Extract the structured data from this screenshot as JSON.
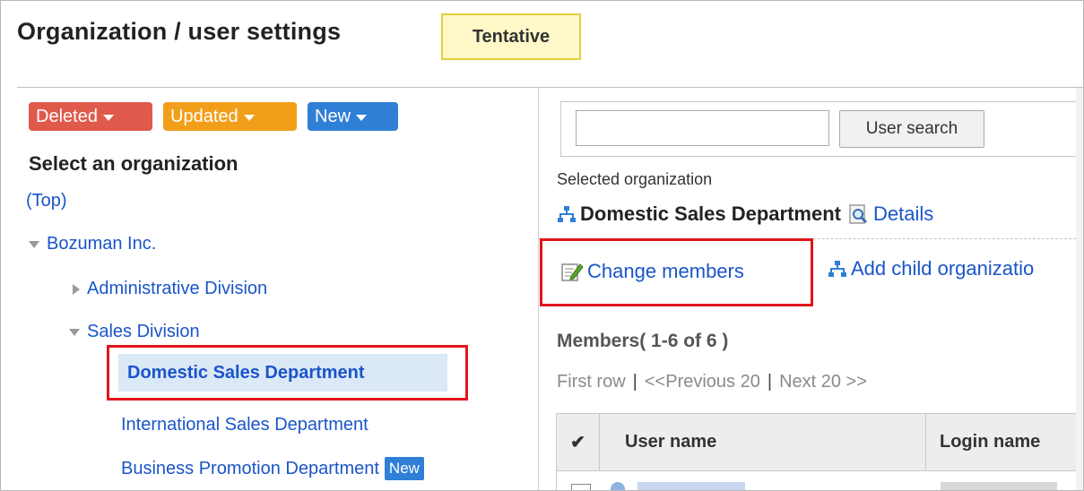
{
  "header": {
    "title": "Organization / user settings",
    "status_badge": "Tentative"
  },
  "filters": {
    "deleted": "Deleted",
    "updated": "Updated",
    "new": "New"
  },
  "tree": {
    "heading": "Select an organization",
    "top_link": "(Top)",
    "company": "Bozuman Inc.",
    "admin_division": "Administrative Division",
    "sales_division": "Sales Division",
    "selected_department": "Domestic Sales Department",
    "international_department": "International Sales Department",
    "promotion_department": "Business Promotion Department",
    "new_badge": "New"
  },
  "search": {
    "value": "",
    "button": "User search"
  },
  "details": {
    "label": "Selected organization",
    "org_name": "Domestic Sales Department",
    "details_link": "Details"
  },
  "actions": {
    "change_members": "Change members",
    "add_child": "Add child organizatio"
  },
  "members": {
    "heading": "Members( 1-6 of 6 )",
    "pager": {
      "first": "First row",
      "sep": "|",
      "prev": "<<Previous 20",
      "next": "Next 20 >>"
    },
    "columns": {
      "check": "✔",
      "user_name": "User name",
      "login_name": "Login name"
    }
  },
  "colors": {
    "link": "#1a55c9",
    "deleted": "#e05a4c",
    "updated": "#f19f1b",
    "new": "#2f7fd6",
    "highlight_border": "#e2141a"
  }
}
